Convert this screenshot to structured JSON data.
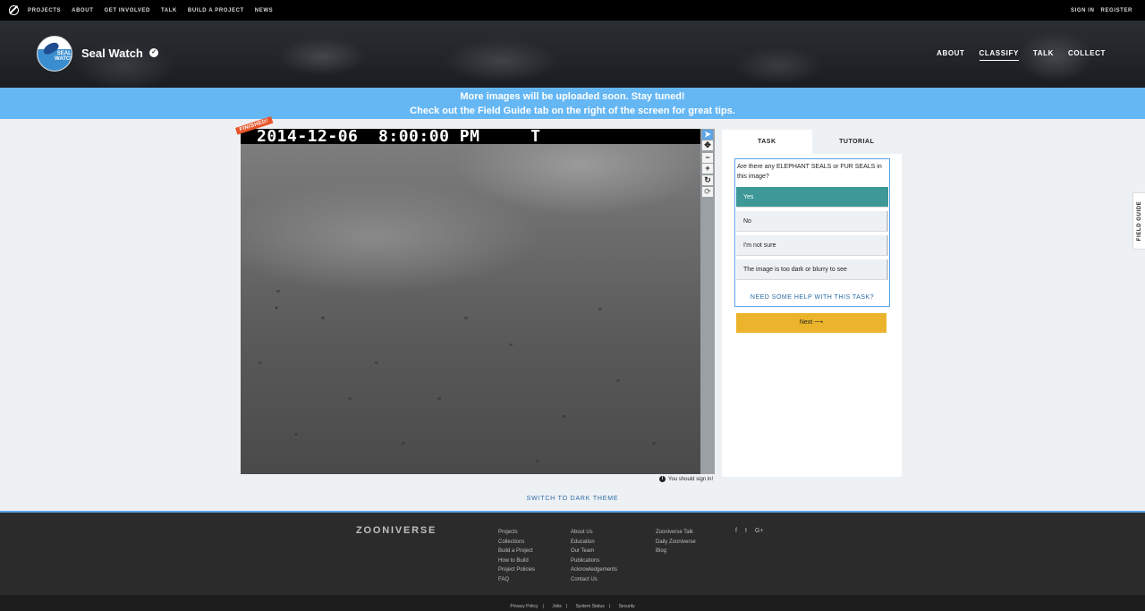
{
  "topbar": {
    "nav": [
      "PROJECTS",
      "ABOUT",
      "GET INVOLVED",
      "TALK",
      "BUILD A PROJECT",
      "NEWS"
    ],
    "sign_in": "SIGN IN",
    "register": "REGISTER"
  },
  "header": {
    "avatar_text": "SEAL WATCH",
    "title": "Seal Watch",
    "nav": [
      {
        "label": "ABOUT",
        "active": false
      },
      {
        "label": "CLASSIFY",
        "active": true
      },
      {
        "label": "TALK",
        "active": false
      },
      {
        "label": "COLLECT",
        "active": false
      }
    ]
  },
  "banner": {
    "line1": "More images will be uploaded soon. Stay tuned!",
    "line2": "Check out the Field Guide tab on the right of the screen for great tips."
  },
  "subject": {
    "timestamp": "2014-12-06  8:00:00 PM     T",
    "finished_badge": "FINISHED!",
    "signin_note": "You should sign in!"
  },
  "toolbar": {
    "tools": [
      "pointer-icon",
      "pan-icon",
      "zoom-out-icon",
      "zoom-in-icon",
      "rotate-icon",
      "reset-icon"
    ]
  },
  "task": {
    "tabs": [
      "TASK",
      "TUTORIAL"
    ],
    "question": "Are there any ELEPHANT SEALS or FUR SEALS in this image?",
    "answers": [
      {
        "label": "Yes",
        "selected": true
      },
      {
        "label": "No",
        "selected": false
      },
      {
        "label": "I'm not sure",
        "selected": false
      },
      {
        "label": "The image is too dark or blurry to see",
        "selected": false
      }
    ],
    "help": "NEED SOME HELP WITH THIS TASK?",
    "next": "Next ⟶"
  },
  "field_guide": "FIELD GUIDE",
  "theme_toggle": "SWITCH TO DARK THEME",
  "footer": {
    "logo": "ZOONIVERSE",
    "col1": [
      "Projects",
      "Collections",
      "Build a Project",
      "How to Build",
      "Project Policies",
      "FAQ"
    ],
    "col2": [
      "About Us",
      "Education",
      "Our Team",
      "Publications",
      "Acknowledgements",
      "Contact Us"
    ],
    "col3": [
      "Zooniverse Talk",
      "Daily Zooniverse",
      "Blog"
    ],
    "social": [
      "f",
      "t",
      "G+"
    ],
    "legal": [
      "Privacy Policy",
      "Jobs",
      "System Status",
      "Security"
    ]
  },
  "colors": {
    "banner": "#65b7f4",
    "selected_answer": "#3d9897",
    "next_button": "#ebb42c",
    "finished_badge": "#e8552a",
    "link": "#2a6aa6"
  }
}
